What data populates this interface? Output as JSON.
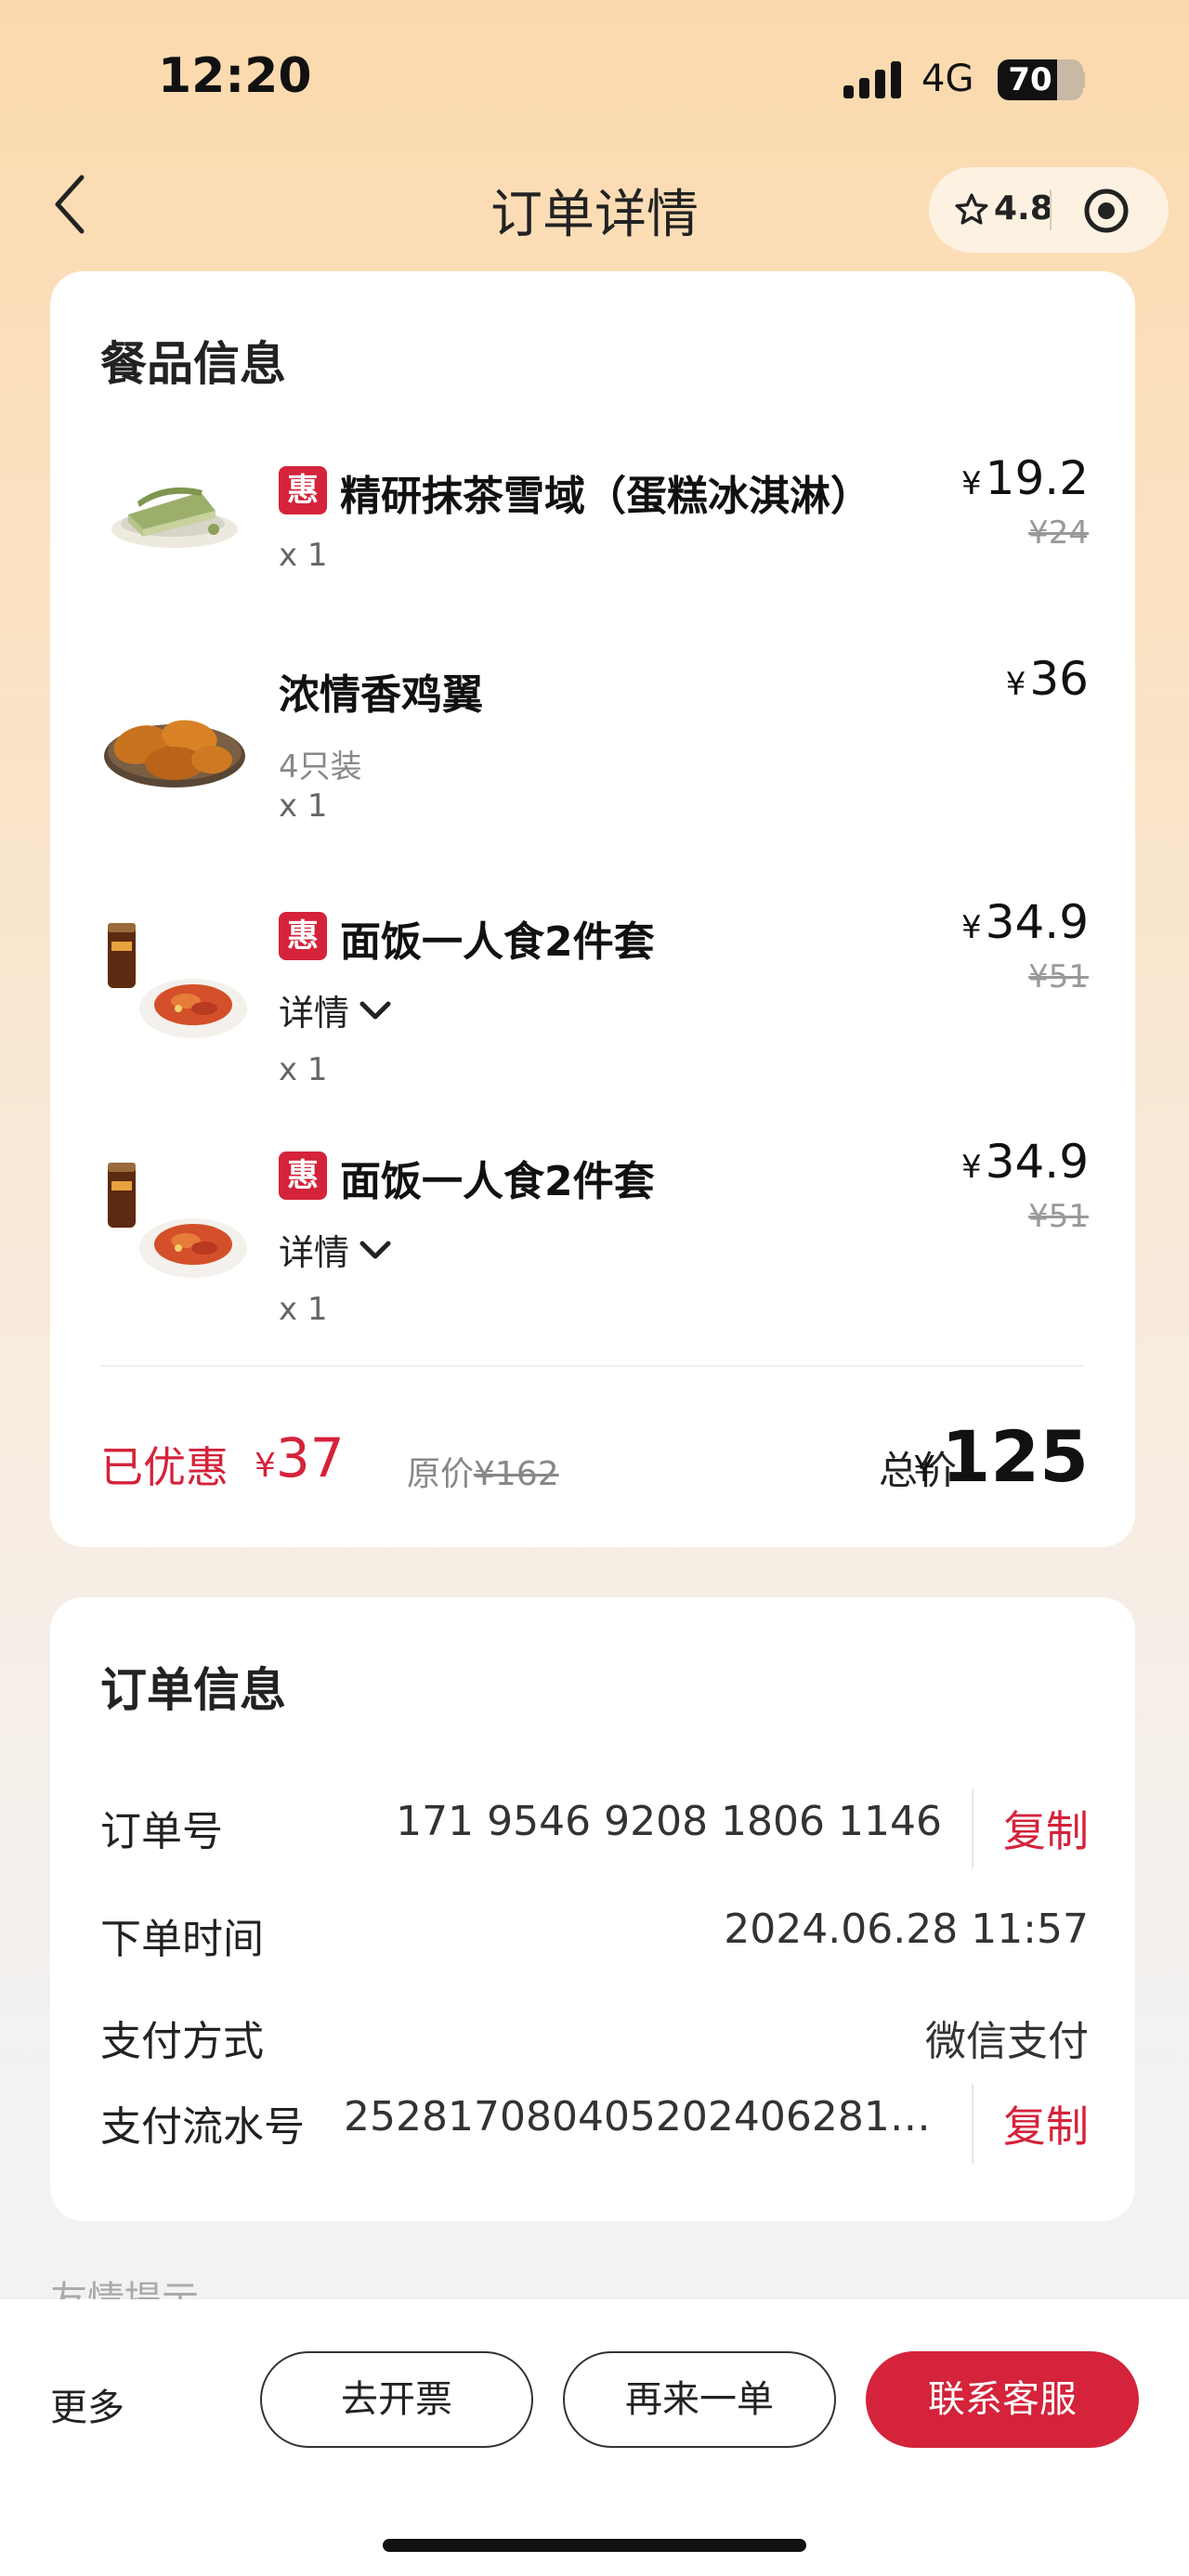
{
  "status_bar": {
    "time": "12:20",
    "network": "4G",
    "battery": "70",
    "battery_level": 0.7
  },
  "header": {
    "title": "订单详情",
    "rating": "4.8",
    "icons": [
      "back-arrow-icon",
      "star-icon",
      "target-icon"
    ]
  },
  "food_card": {
    "title": "餐品信息",
    "items": [
      {
        "badge": "惠",
        "name": "精研抹茶雪域（蛋糕冰淇淋）",
        "spec": "",
        "detail": "",
        "qty": "x 1",
        "currency": "¥",
        "price": "19.2",
        "original": "¥24"
      },
      {
        "badge": "",
        "name": "浓情香鸡翼",
        "spec": "4只装",
        "detail": "",
        "qty": "x 1",
        "currency": "¥",
        "price": "36",
        "original": ""
      },
      {
        "badge": "惠",
        "name": "面饭一人食2件套",
        "spec": "",
        "detail": "详情",
        "qty": "x 1",
        "currency": "¥",
        "price": "34.9",
        "original": "¥51"
      },
      {
        "badge": "惠",
        "name": "面饭一人食2件套",
        "spec": "",
        "detail": "详情",
        "qty": "x 1",
        "currency": "¥",
        "price": "34.9",
        "original": "¥51"
      }
    ],
    "summary": {
      "saved_label": "已优惠",
      "currency": "¥",
      "saved_amount": "37",
      "original_label": "原价",
      "original_total": "¥162",
      "total_label": "总价",
      "total": "125"
    }
  },
  "order_card": {
    "title": "订单信息",
    "rows": {
      "order_no_label": "订单号",
      "order_no": "171 9546 9208 1806 1146",
      "copy": "复制",
      "time_label": "下单时间",
      "time": "2024.06.28 11:57",
      "pay_method_label": "支付方式",
      "pay_method": "微信支付",
      "serial_label": "支付流水号",
      "serial": "252817080405202406281…"
    }
  },
  "tip_peek": "友情提示",
  "bottom_bar": {
    "more": "更多",
    "invoice": "去开票",
    "reorder": "再来一单",
    "contact": "联系客服"
  },
  "colors": {
    "accent": "#d4233a",
    "background_top": "#fbd9ad",
    "card": "#ffffff"
  }
}
